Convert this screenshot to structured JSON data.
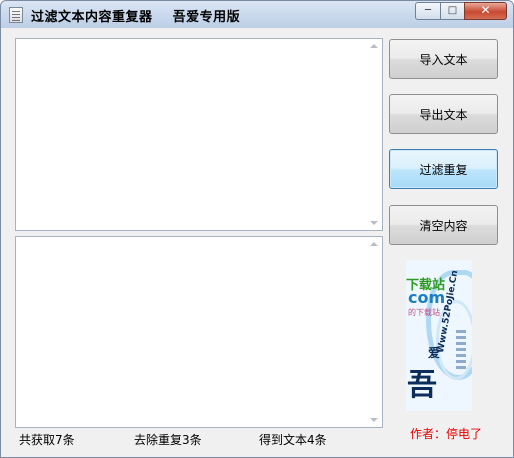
{
  "window": {
    "title": "过滤文本内容重复器    吾爱专用版",
    "controls": {
      "minimize": "─",
      "maximize": "□",
      "close": "✕"
    }
  },
  "buttons": {
    "import": "导入文本",
    "export": "导出文本",
    "filter": "过滤重复",
    "clear": "清空内容"
  },
  "status": {
    "total": "共获取7条",
    "removed": "去除重复3条",
    "result": "得到文本4条"
  },
  "logo": {
    "site_cn": "下载站",
    "site_domain": "com",
    "site_small": "的下载站",
    "brand_char_1": "吾",
    "brand_char_2": "爱",
    "brand_url": "Www.52PoJie.Cn",
    "colors": {
      "green": "#2f9a22",
      "blue": "#1a7fc1",
      "navy": "#0c2c5a"
    }
  },
  "author": "作者：停电了",
  "icons": [
    "app-icon",
    "minimize-icon",
    "maximize-icon",
    "close-icon",
    "scroll-up-arrow-icon",
    "scroll-down-arrow-icon"
  ]
}
